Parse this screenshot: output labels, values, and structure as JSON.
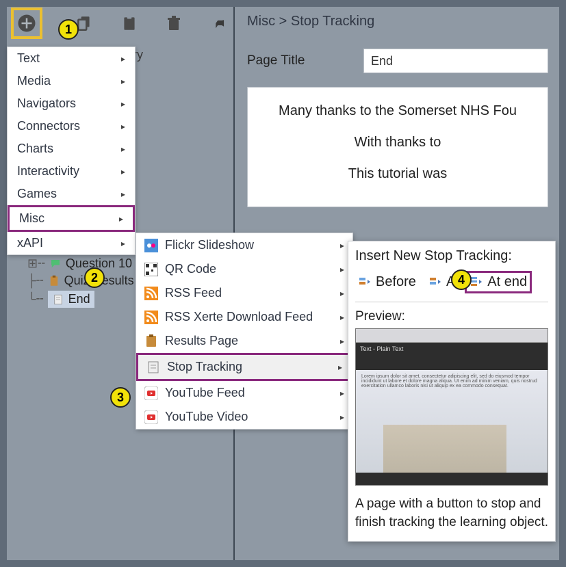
{
  "toolbar": {},
  "tree": {
    "topHidden": "stry",
    "items": [
      {
        "label": "Question 10",
        "icon": "speech"
      },
      {
        "label": "Quiz Results",
        "icon": "clipboard"
      },
      {
        "label": "End",
        "icon": "doc",
        "selected": true
      }
    ]
  },
  "breadcrumb": {
    "parent": "Misc",
    "sep": ">",
    "current": "Stop Tracking"
  },
  "form": {
    "pageTitleLabel": "Page Title",
    "pageTitleValue": "End"
  },
  "content": {
    "p1": "Many thanks to the Somerset NHS Fou",
    "p2": "With thanks to",
    "p3": "This tutorial was"
  },
  "menu": {
    "items": [
      {
        "label": "Text"
      },
      {
        "label": "Media"
      },
      {
        "label": "Navigators"
      },
      {
        "label": "Connectors"
      },
      {
        "label": "Charts"
      },
      {
        "label": "Interactivity"
      },
      {
        "label": "Games"
      },
      {
        "label": "Misc",
        "highlight": true
      },
      {
        "label": "xAPI"
      }
    ]
  },
  "submenu": {
    "items": [
      {
        "label": "Flickr Slideshow",
        "icon": "flickr"
      },
      {
        "label": "QR Code",
        "icon": "qr"
      },
      {
        "label": "RSS Feed",
        "icon": "rss"
      },
      {
        "label": "RSS Xerte Download Feed",
        "icon": "rss"
      },
      {
        "label": "Results Page",
        "icon": "clipboard"
      },
      {
        "label": "Stop Tracking",
        "icon": "doc",
        "highlight": true
      },
      {
        "label": "YouTube Feed",
        "icon": "yt"
      },
      {
        "label": "YouTube Video",
        "icon": "yt"
      }
    ]
  },
  "popup": {
    "heading": "Insert New Stop Tracking:",
    "beforeLabel": "Before",
    "afterLabel": "A",
    "atEndLabel": "At end",
    "previewLabel": "Preview:",
    "pvTitle": "Text - Plain Text",
    "description": "A page with a button to stop and finish tracking the learning object."
  },
  "callouts": {
    "c1": "1",
    "c2": "2",
    "c3": "3",
    "c4": "4"
  }
}
